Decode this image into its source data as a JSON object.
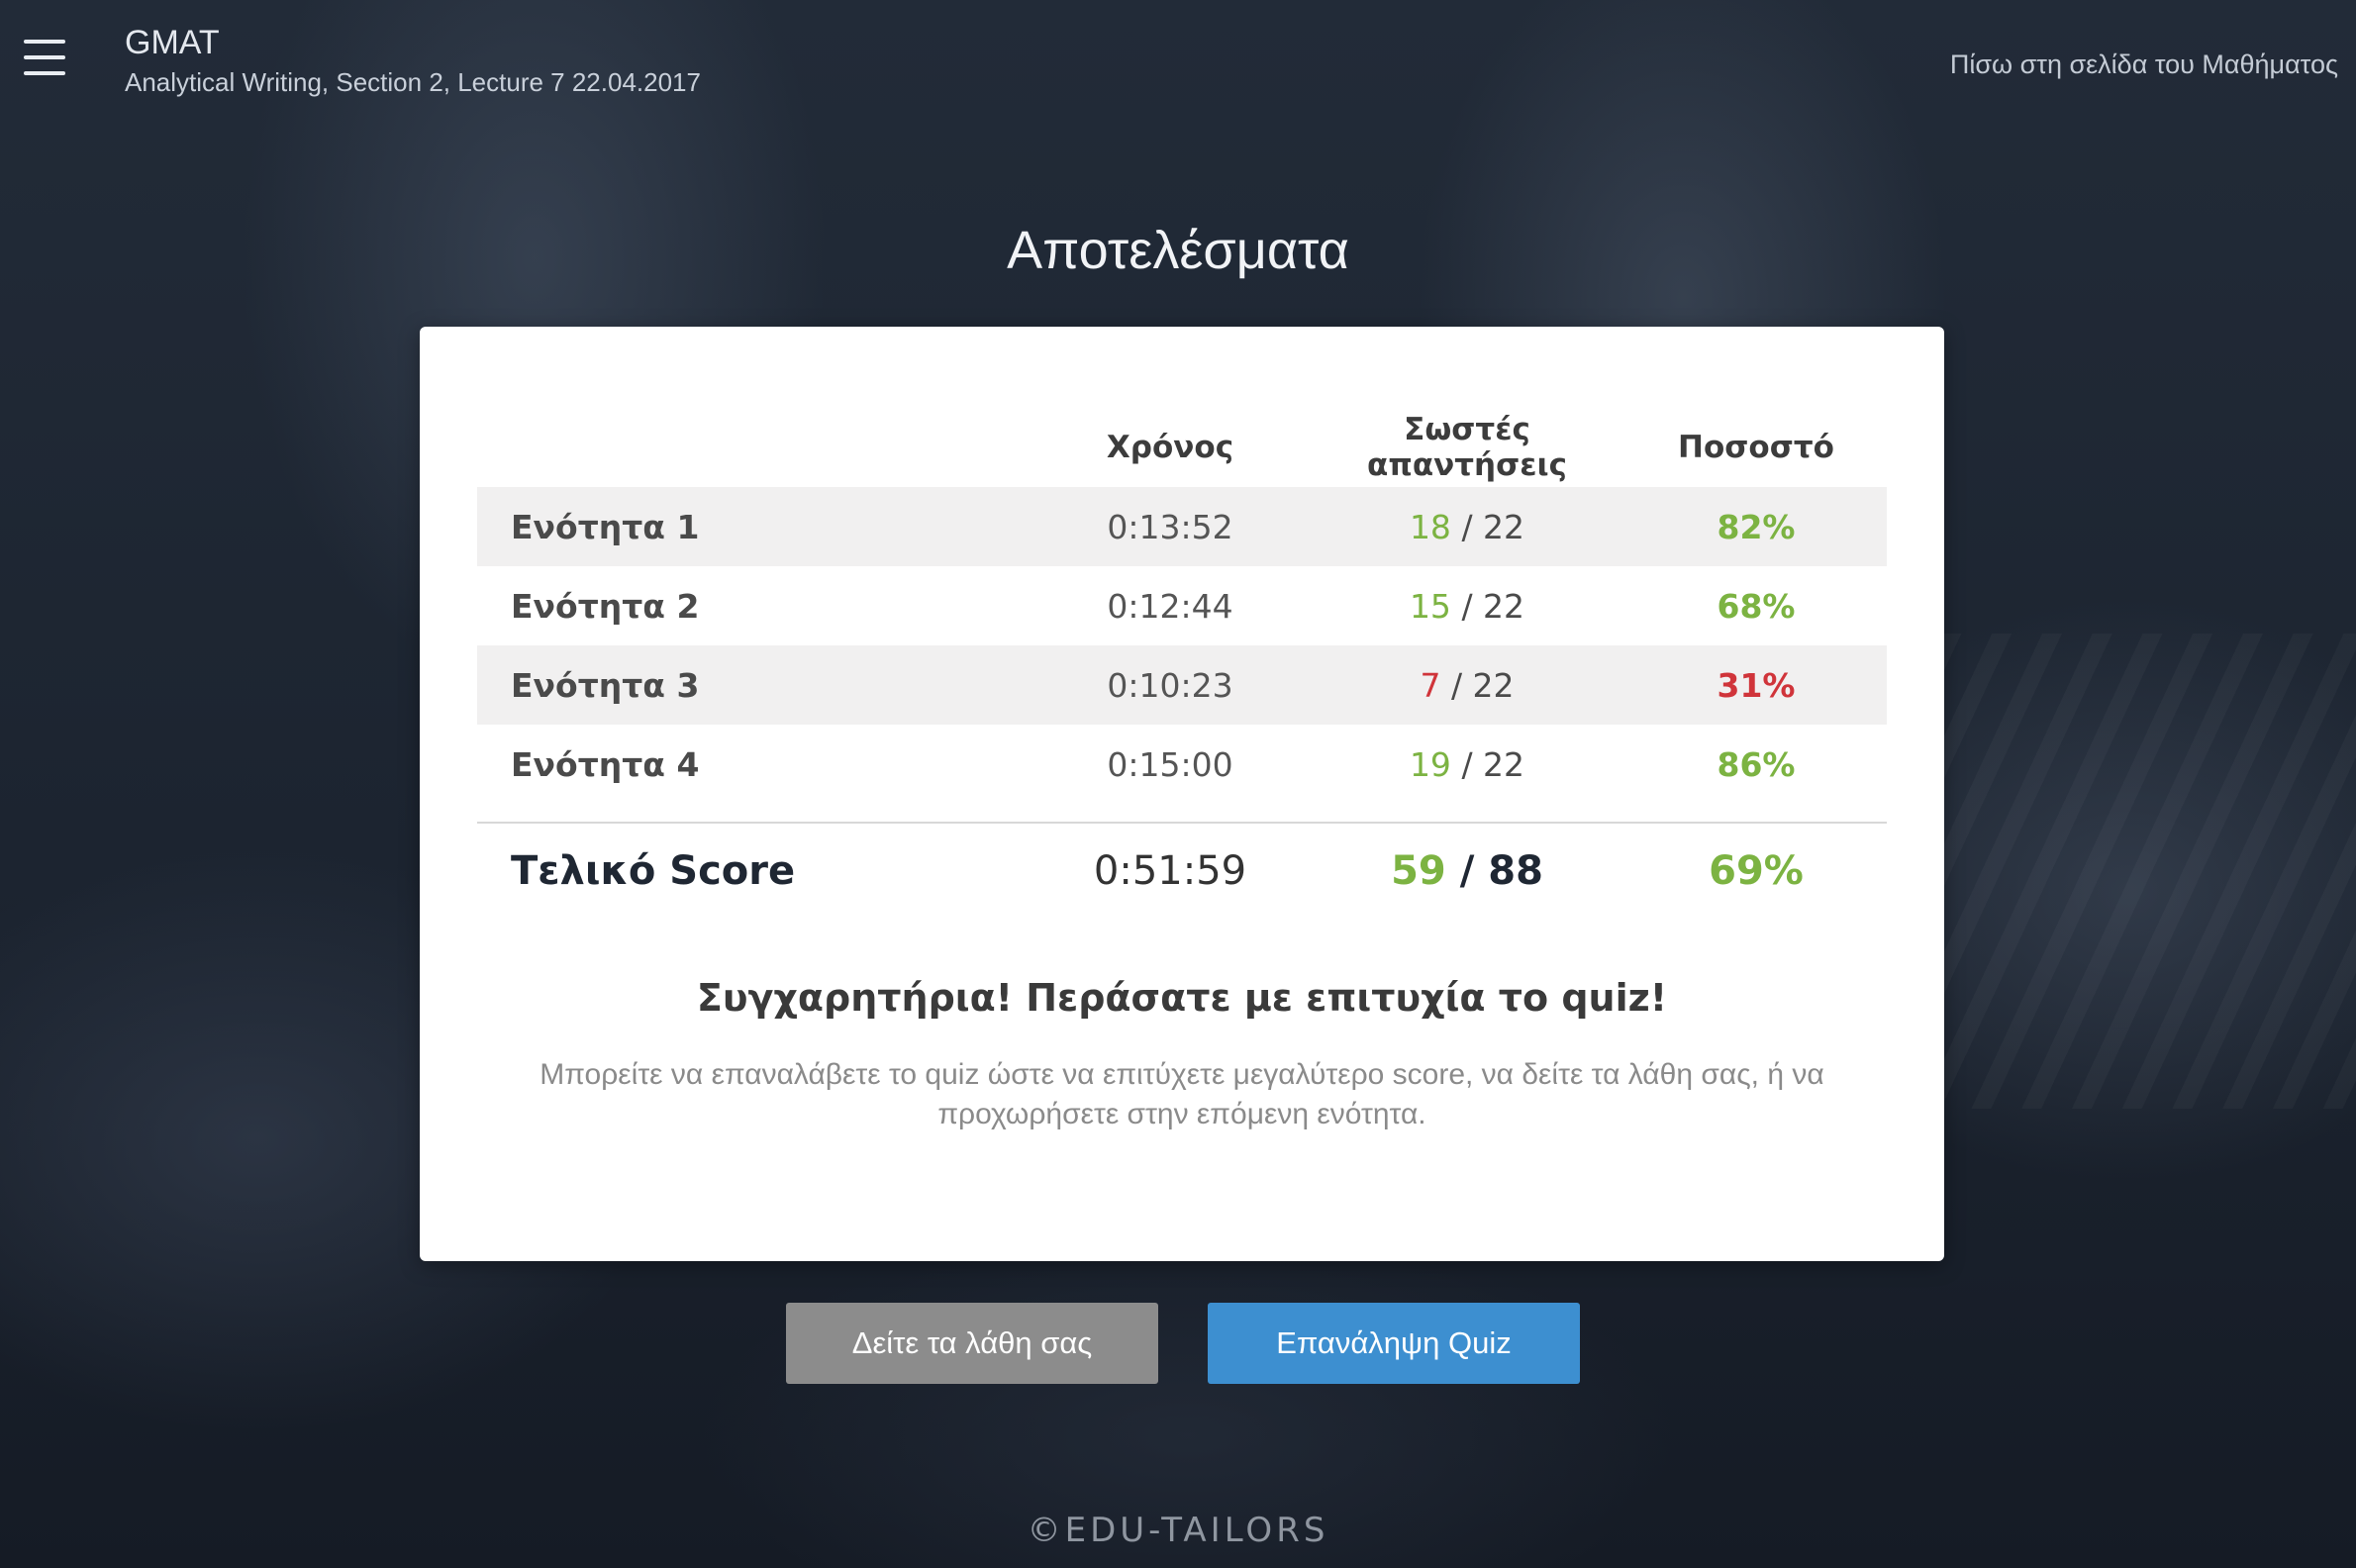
{
  "header": {
    "course_title": "GMAT",
    "course_subtitle": "Analytical Writing, Section 2, Lecture 7 22.04.2017",
    "back_link": "Πίσω στη σελίδα του Μαθήματος",
    "menu_icon": "hamburger-menu-icon"
  },
  "page_title": "Αποτελέσματα",
  "results": {
    "columns": [
      "",
      "Χρόνος",
      "Σωστές απαντήσεις",
      "Ποσοστό"
    ],
    "rows": [
      {
        "name": "Ενότητα 1",
        "time": "0:13:52",
        "correct": "18",
        "total": "/ 22",
        "percent": "82%",
        "status": "pass"
      },
      {
        "name": "Ενότητα 2",
        "time": "0:12:44",
        "correct": "15",
        "total": "/ 22",
        "percent": "68%",
        "status": "pass"
      },
      {
        "name": "Ενότητα 3",
        "time": "0:10:23",
        "correct": "7",
        "total": "/ 22",
        "percent": "31%",
        "status": "fail"
      },
      {
        "name": "Ενότητα 4",
        "time": "0:15:00",
        "correct": "19",
        "total": "/ 22",
        "percent": "86%",
        "status": "pass"
      }
    ],
    "final": {
      "name": "Τελικό Score",
      "time": "0:51:59",
      "correct": "59",
      "total": "/ 88",
      "percent": "69%"
    }
  },
  "message": {
    "title": "Συγχαρητήρια! Περάσατε με επιτυχία το quiz!",
    "text": "Μπορείτε να επαναλάβετε το quiz ώστε να επιτύχετε μεγαλύτερο score, να δείτε τα λάθη σας, ή να προχωρήσετε στην επόμενη ενότητα."
  },
  "buttons": {
    "mistakes": "Δείτε τα λάθη σας",
    "retry": "Επανάληψη Quiz"
  },
  "footer": "©EDU-TAILORS",
  "colors": {
    "pass": "#7cb342",
    "fail": "#d0343a",
    "primary_button": "#3d8fd0",
    "secondary_button": "#8c8c8c"
  }
}
